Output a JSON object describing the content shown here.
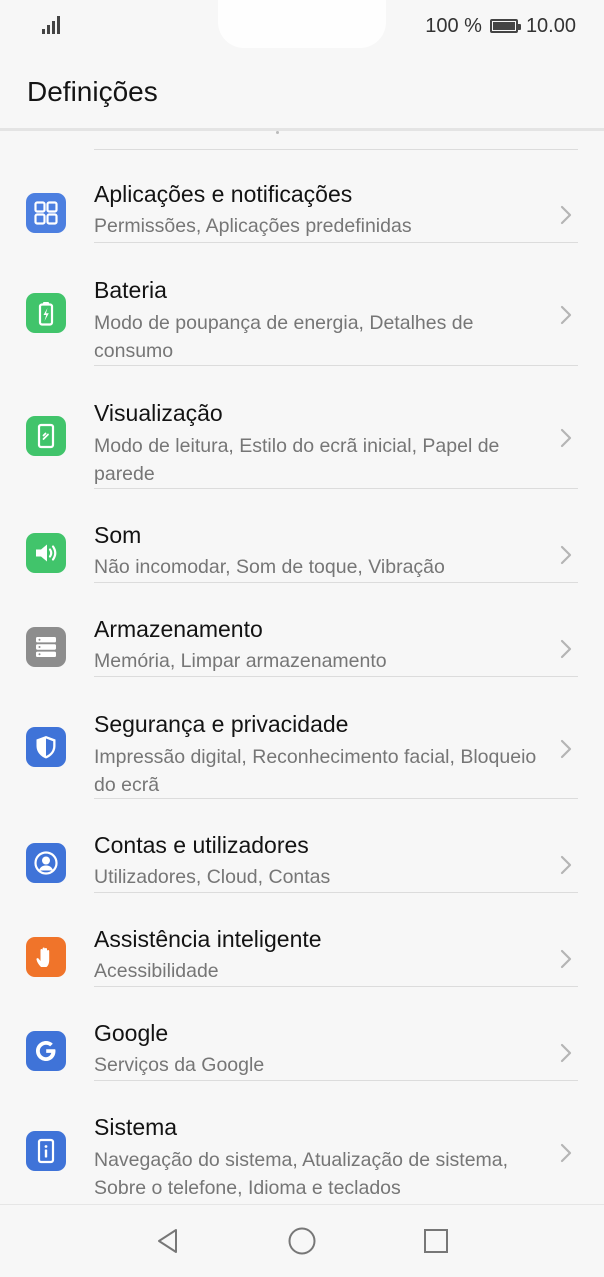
{
  "status_bar": {
    "battery_percent": "100 %",
    "battery_level": 1.0,
    "time": "10.00"
  },
  "header": {
    "title": "Definições"
  },
  "settings": [
    {
      "name": "apps-notifications",
      "title": "Aplicações e notificações",
      "subtitle": "Permissões, Aplicações predefinidas",
      "icon": "apps-grid-icon",
      "color": "#4c7fe0"
    },
    {
      "name": "battery",
      "title": "Bateria",
      "subtitle": "Modo de poupança de energia, Detalhes de consumo",
      "icon": "battery-charging-icon",
      "color": "#41c46b"
    },
    {
      "name": "display",
      "title": "Visualização",
      "subtitle": "Modo de leitura, Estilo do ecrã inicial, Papel de parede",
      "icon": "phone-display-icon",
      "color": "#41c46b"
    },
    {
      "name": "sound",
      "title": "Som",
      "subtitle": "Não incomodar, Som de toque, Vibração",
      "icon": "speaker-icon",
      "color": "#41c46b"
    },
    {
      "name": "storage",
      "title": "Armazenamento",
      "subtitle": "Memória, Limpar armazenamento",
      "icon": "storage-icon",
      "color": "#8d8d8d"
    },
    {
      "name": "security-privacy",
      "title": "Segurança e privacidade",
      "subtitle": "Impressão digital, Reconhecimento facial, Bloqueio do ecrã",
      "icon": "shield-icon",
      "color": "#3f73d8"
    },
    {
      "name": "accounts-users",
      "title": "Contas e utilizadores",
      "subtitle": "Utilizadores, Cloud, Contas",
      "icon": "user-icon",
      "color": "#3f73d8"
    },
    {
      "name": "smart-assistance",
      "title": "Assistência inteligente",
      "subtitle": "Acessibilidade",
      "icon": "hand-icon",
      "color": "#f0742a"
    },
    {
      "name": "google",
      "title": "Google",
      "subtitle": "Serviços da Google",
      "icon": "google-icon",
      "color": "#3f73d8"
    },
    {
      "name": "system",
      "title": "Sistema",
      "subtitle": "Navegação do sistema, Atualização de sistema, Sobre o telefone, Idioma e teclados",
      "icon": "info-icon",
      "color": "#3f73d8"
    }
  ],
  "nav_bar": {
    "buttons": [
      "back-icon",
      "home-icon",
      "recents-icon"
    ]
  }
}
